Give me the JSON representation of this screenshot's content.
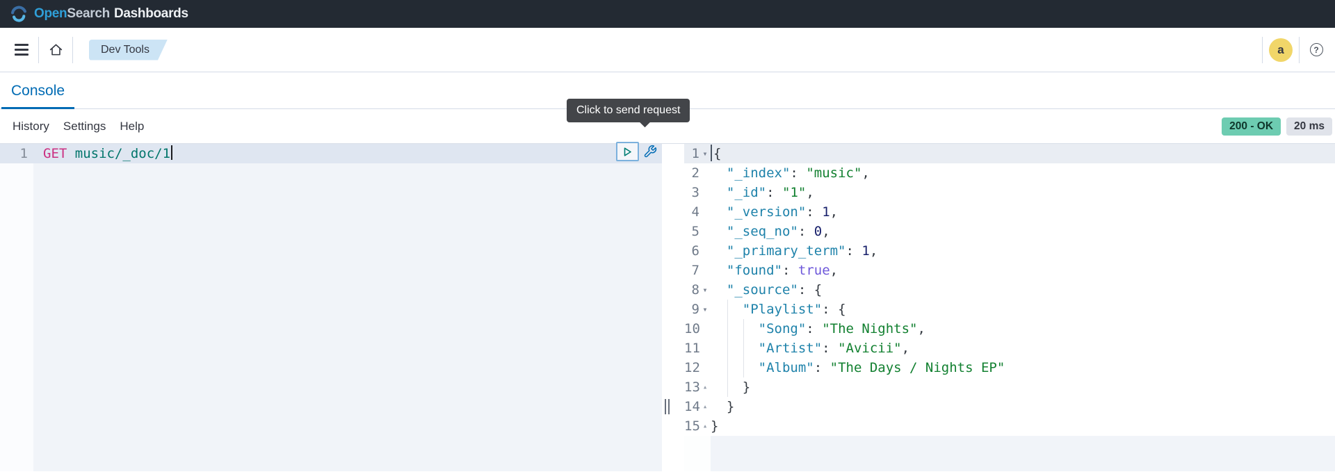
{
  "header": {
    "brand_open": "Open",
    "brand_search": "Search",
    "brand_dashboards": "Dashboards",
    "bar_color": "#232a33"
  },
  "nav": {
    "breadcrumb": "Dev Tools",
    "avatar_initial": "a",
    "help_glyph": "?"
  },
  "tabs": {
    "console": "Console"
  },
  "toolbar": {
    "menu": [
      "History",
      "Settings",
      "Help"
    ],
    "status_badge": "200 - OK",
    "time_badge": "20 ms",
    "status_color": "#6dccb1",
    "time_color": "#e0e3ea"
  },
  "tooltip": {
    "text": "Click to send request"
  },
  "icons": {
    "fold_open": "▾",
    "fold_close": "▴"
  },
  "colors": {
    "accent": "#006bb4",
    "method": "#cb2f81",
    "url": "#01756b",
    "json_key": "#1e82aa",
    "json_string": "#128030",
    "json_number": "#18206b",
    "json_boolean": "#6e58da",
    "active_line": "#dfe6f1",
    "tooltip_bg": "#434549"
  },
  "editor": {
    "lines": [
      {
        "n": "1",
        "active": true,
        "caret": "end",
        "tokens": [
          [
            "method",
            "GET"
          ],
          [
            "txt",
            " "
          ],
          [
            "url",
            "music/_doc/1"
          ]
        ]
      }
    ]
  },
  "response": {
    "lines": [
      {
        "n": "1",
        "active": true,
        "fold": "open",
        "caret": "pre",
        "tokens": [
          [
            "punct",
            "{"
          ]
        ]
      },
      {
        "n": "2",
        "tokens": [
          [
            "txt",
            "  "
          ],
          [
            "key",
            "\"_index\""
          ],
          [
            "punct",
            ":"
          ],
          [
            "txt",
            " "
          ],
          [
            "str",
            "\"music\""
          ],
          [
            "punct",
            ","
          ]
        ]
      },
      {
        "n": "3",
        "tokens": [
          [
            "txt",
            "  "
          ],
          [
            "key",
            "\"_id\""
          ],
          [
            "punct",
            ":"
          ],
          [
            "txt",
            " "
          ],
          [
            "str",
            "\"1\""
          ],
          [
            "punct",
            ","
          ]
        ]
      },
      {
        "n": "4",
        "tokens": [
          [
            "txt",
            "  "
          ],
          [
            "key",
            "\"_version\""
          ],
          [
            "punct",
            ":"
          ],
          [
            "txt",
            " "
          ],
          [
            "num",
            "1"
          ],
          [
            "punct",
            ","
          ]
        ]
      },
      {
        "n": "5",
        "tokens": [
          [
            "txt",
            "  "
          ],
          [
            "key",
            "\"_seq_no\""
          ],
          [
            "punct",
            ":"
          ],
          [
            "txt",
            " "
          ],
          [
            "num",
            "0"
          ],
          [
            "punct",
            ","
          ]
        ]
      },
      {
        "n": "6",
        "tokens": [
          [
            "txt",
            "  "
          ],
          [
            "key",
            "\"_primary_term\""
          ],
          [
            "punct",
            ":"
          ],
          [
            "txt",
            " "
          ],
          [
            "num",
            "1"
          ],
          [
            "punct",
            ","
          ]
        ]
      },
      {
        "n": "7",
        "tokens": [
          [
            "txt",
            "  "
          ],
          [
            "key",
            "\"found\""
          ],
          [
            "punct",
            ":"
          ],
          [
            "txt",
            " "
          ],
          [
            "bool",
            "true"
          ],
          [
            "punct",
            ","
          ]
        ]
      },
      {
        "n": "8",
        "fold": "open",
        "tokens": [
          [
            "txt",
            "  "
          ],
          [
            "key",
            "\"_source\""
          ],
          [
            "punct",
            ":"
          ],
          [
            "txt",
            " "
          ],
          [
            "punct",
            "{"
          ]
        ]
      },
      {
        "n": "9",
        "fold": "open",
        "tokens": [
          [
            "txt",
            "    "
          ],
          [
            "key",
            "\"Playlist\""
          ],
          [
            "punct",
            ":"
          ],
          [
            "txt",
            " "
          ],
          [
            "punct",
            "{"
          ]
        ]
      },
      {
        "n": "10",
        "tokens": [
          [
            "txt",
            "      "
          ],
          [
            "key",
            "\"Song\""
          ],
          [
            "punct",
            ":"
          ],
          [
            "txt",
            " "
          ],
          [
            "str",
            "\"The Nights\""
          ],
          [
            "punct",
            ","
          ]
        ]
      },
      {
        "n": "11",
        "tokens": [
          [
            "txt",
            "      "
          ],
          [
            "key",
            "\"Artist\""
          ],
          [
            "punct",
            ":"
          ],
          [
            "txt",
            " "
          ],
          [
            "str",
            "\"Avicii\""
          ],
          [
            "punct",
            ","
          ]
        ]
      },
      {
        "n": "12",
        "tokens": [
          [
            "txt",
            "      "
          ],
          [
            "key",
            "\"Album\""
          ],
          [
            "punct",
            ":"
          ],
          [
            "txt",
            " "
          ],
          [
            "str",
            "\"The Days / Nights EP\""
          ]
        ]
      },
      {
        "n": "13",
        "fold": "close",
        "tokens": [
          [
            "txt",
            "    "
          ],
          [
            "punct",
            "}"
          ]
        ]
      },
      {
        "n": "14",
        "fold": "close",
        "tokens": [
          [
            "txt",
            "  "
          ],
          [
            "punct",
            "}"
          ]
        ]
      },
      {
        "n": "15",
        "fold": "close",
        "tokens": [
          [
            "punct",
            "}"
          ]
        ]
      }
    ]
  }
}
